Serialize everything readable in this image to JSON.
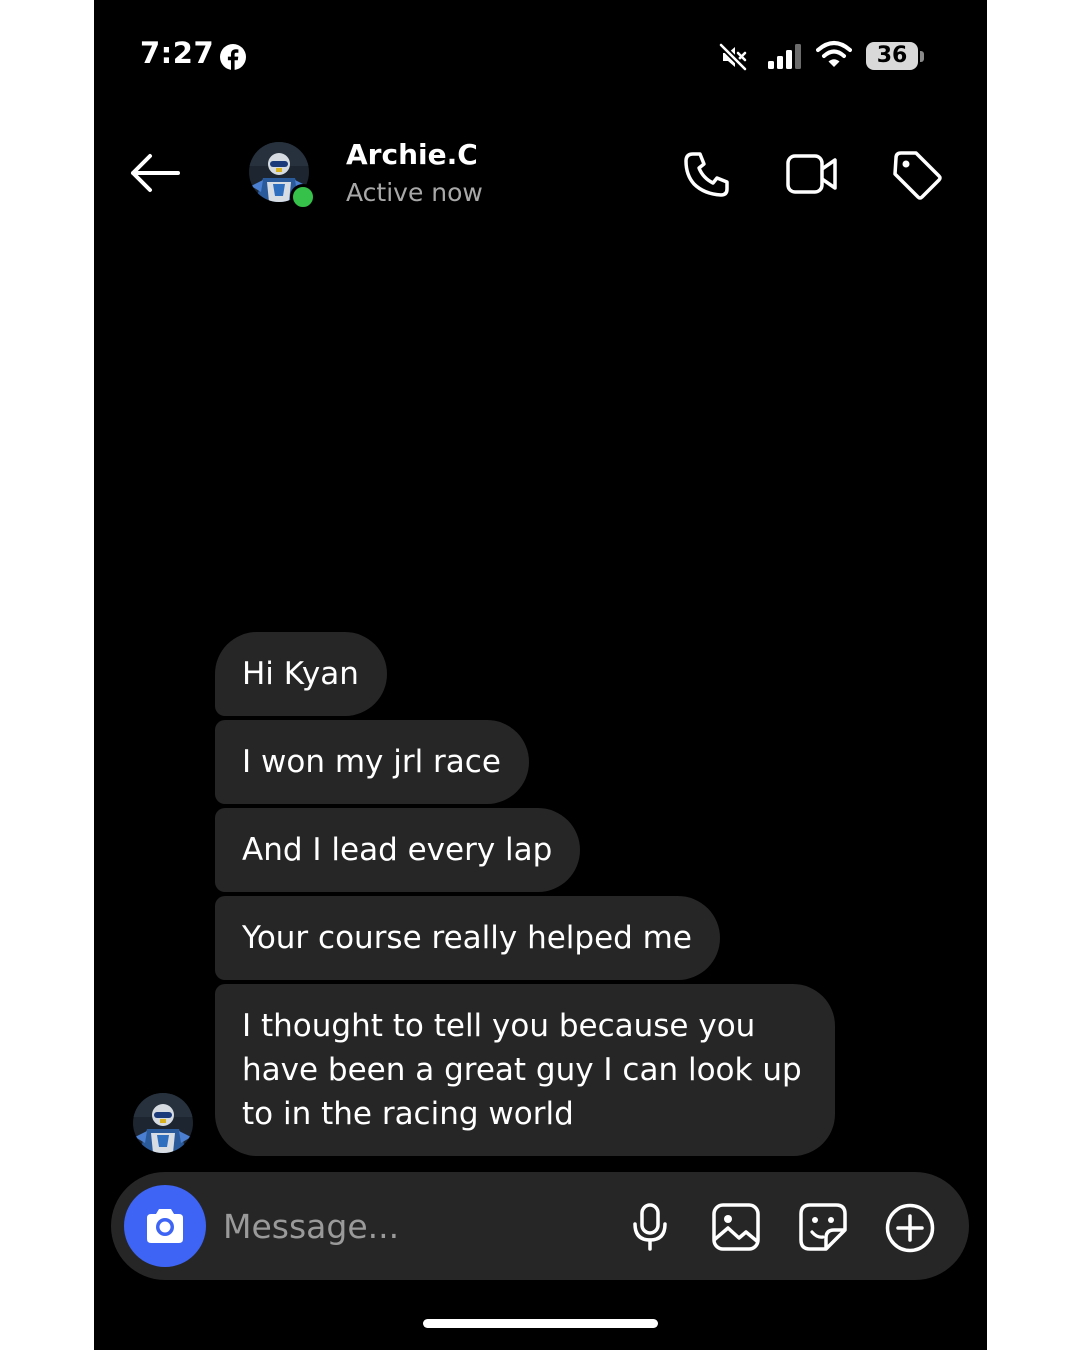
{
  "status_bar": {
    "time": "7:27",
    "battery": "36",
    "icons": [
      "facebook-icon",
      "mute-icon",
      "signal-icon",
      "wifi-icon",
      "battery-icon"
    ]
  },
  "header": {
    "contact_name": "Archie.C",
    "contact_status": "Active now",
    "icons": [
      "back-arrow-icon",
      "phone-icon",
      "video-icon",
      "tag-icon"
    ]
  },
  "messages": [
    {
      "sender": "Archie.C",
      "text": "Hi Kyan"
    },
    {
      "sender": "Archie.C",
      "text": "I won my jrl race"
    },
    {
      "sender": "Archie.C",
      "text": "And I lead every lap"
    },
    {
      "sender": "Archie.C",
      "text": "Your course really helped me"
    },
    {
      "sender": "Archie.C",
      "text": "I thought to tell you because you have been a great guy I can look up to in the racing world"
    }
  ],
  "composer": {
    "placeholder": "Message...",
    "icons": [
      "camera-icon",
      "microphone-icon",
      "gallery-icon",
      "sticker-icon",
      "plus-icon"
    ]
  },
  "colors": {
    "background": "#000000",
    "bubble": "#262626",
    "accent": "#3d64f5",
    "online": "#36c14a",
    "secondary_text": "#a8a8a8"
  }
}
